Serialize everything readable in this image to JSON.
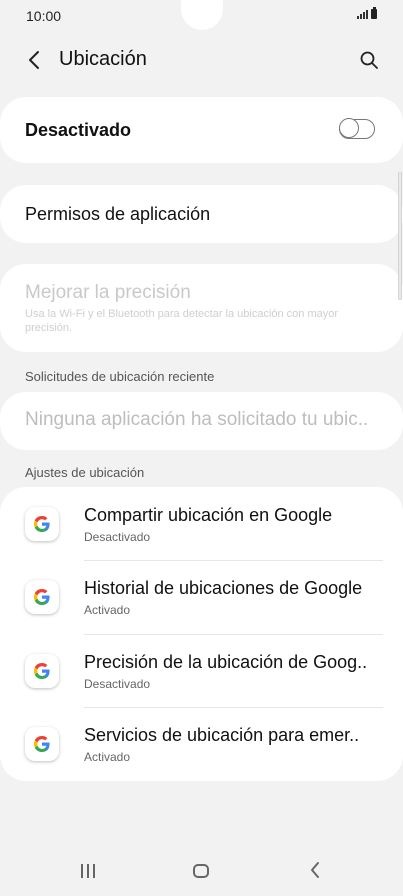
{
  "status_bar": {
    "time": "10:00",
    "signal_icon": "signal-icon",
    "battery_icon": "battery-icon"
  },
  "app_bar": {
    "title": "Ubicación",
    "back_icon": "chevron-left-icon",
    "search_icon": "search-icon"
  },
  "master_switch": {
    "label": "Desactivado",
    "state": "off"
  },
  "app_permissions": {
    "label": "Permisos de aplicación"
  },
  "improve_accuracy": {
    "label": "Mejorar la precisión",
    "description": "Usa la Wi-Fi y el Bluetooth para detectar la ubicación con mayor precisión.",
    "enabled": false
  },
  "recent_requests": {
    "header": "Solicitudes de ubicación reciente",
    "empty_text": "Ninguna aplicación ha solicitado tu ubic.."
  },
  "location_settings": {
    "header": "Ajustes de ubicación",
    "items": [
      {
        "title": "Compartir ubicación en Google",
        "status": "Desactivado",
        "icon": "google-icon"
      },
      {
        "title": "Historial de ubicaciones de Google",
        "status": "Activado",
        "icon": "google-icon"
      },
      {
        "title": "Precisión de la ubicación de Goog..",
        "status": "Desactivado",
        "icon": "google-icon"
      },
      {
        "title": "Servicios de ubicación para emer..",
        "status": "Activado",
        "icon": "google-icon"
      }
    ]
  },
  "nav_bar": {
    "recent_icon": "recent-apps-icon",
    "home_icon": "home-icon",
    "back_icon": "back-icon"
  },
  "colors": {
    "background": "#f2f2f2",
    "card": "#ffffff",
    "disabled_text": "#c9c9c9"
  }
}
